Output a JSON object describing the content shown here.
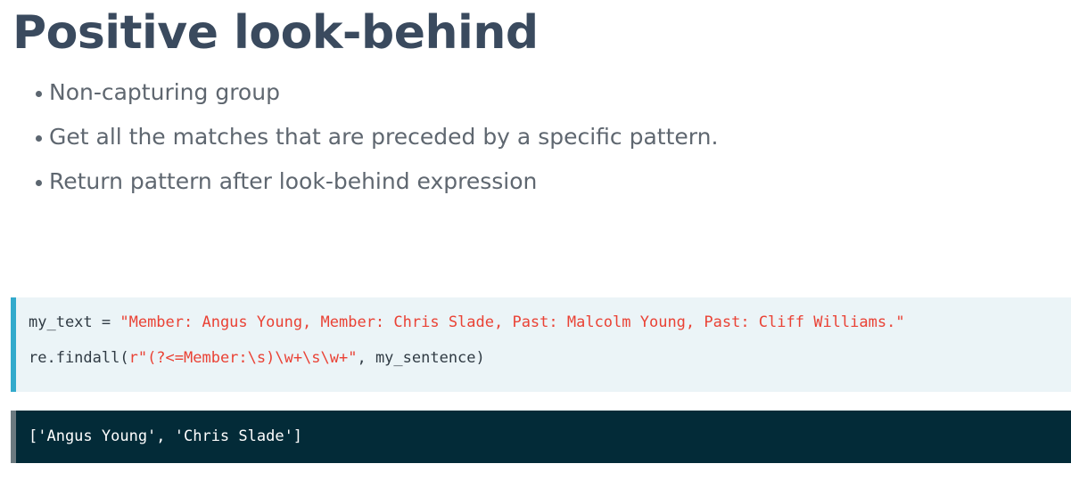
{
  "slide": {
    "title": "Positive look-behind",
    "bullets": [
      "Non-capturing group",
      "Get all the matches that are preceded by a specific pattern.",
      "Return pattern after look-behind expression"
    ]
  },
  "code": {
    "line1_prefix": "my_text = ",
    "line1_string": "\"Member: Angus Young, Member: Chris Slade, Past: Malcolm Young, Past: Cliff Williams.\"",
    "line2_prefix": "re.findall(",
    "line2_string": "r\"(?<=Member:\\s)\\w+\\s\\w+\"",
    "line2_suffix": ", my_sentence)"
  },
  "output": {
    "text": "['Angus Young', 'Chris Slade']"
  },
  "colors": {
    "title": "#3a4a5e",
    "code_background": "#ebf4f7",
    "code_accent": "#33aacc",
    "string_literal": "#ea4235",
    "output_background": "#032b38"
  }
}
